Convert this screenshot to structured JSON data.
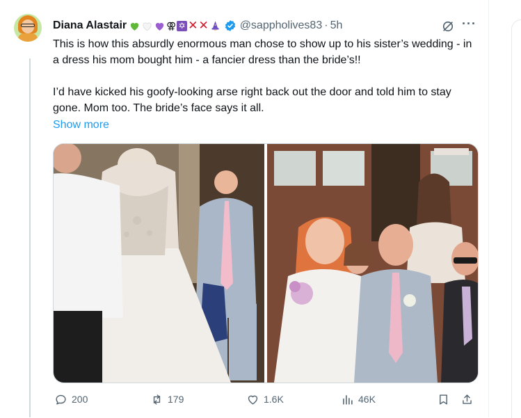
{
  "author": {
    "name": "Diana Alastair",
    "handle": "@sappholives83",
    "separator": "·",
    "time": "5h",
    "emoji_badges": [
      "green-heart",
      "white-heart",
      "purple-heart",
      "sapphic-symbol",
      "star-of-david",
      "red-x",
      "red-x",
      "wizard"
    ],
    "verified_color": "#1d9bf0"
  },
  "tweet": {
    "paragraph1": "This is how this absurdly enormous man chose to show up to his sister’s wedding - in a dress his mom bought him - a fancier dress than the bride’s!!",
    "paragraph2": "I’d have kicked his goofy-looking arse right back out the door and told him to stay gone. Mom too. The bride’s face says it all.",
    "show_more": "Show more"
  },
  "media": {
    "left_image": "wedding-dress-photo",
    "right_image": "wedding-group-photo"
  },
  "actions": {
    "reply_count": "200",
    "repost_count": "179",
    "like_count": "1.6K",
    "view_count": "46K"
  },
  "colors": {
    "accent": "#1d9bf0",
    "secondary_text": "#536471",
    "border": "#cfd9de",
    "repost_green": "#00ba7c"
  }
}
